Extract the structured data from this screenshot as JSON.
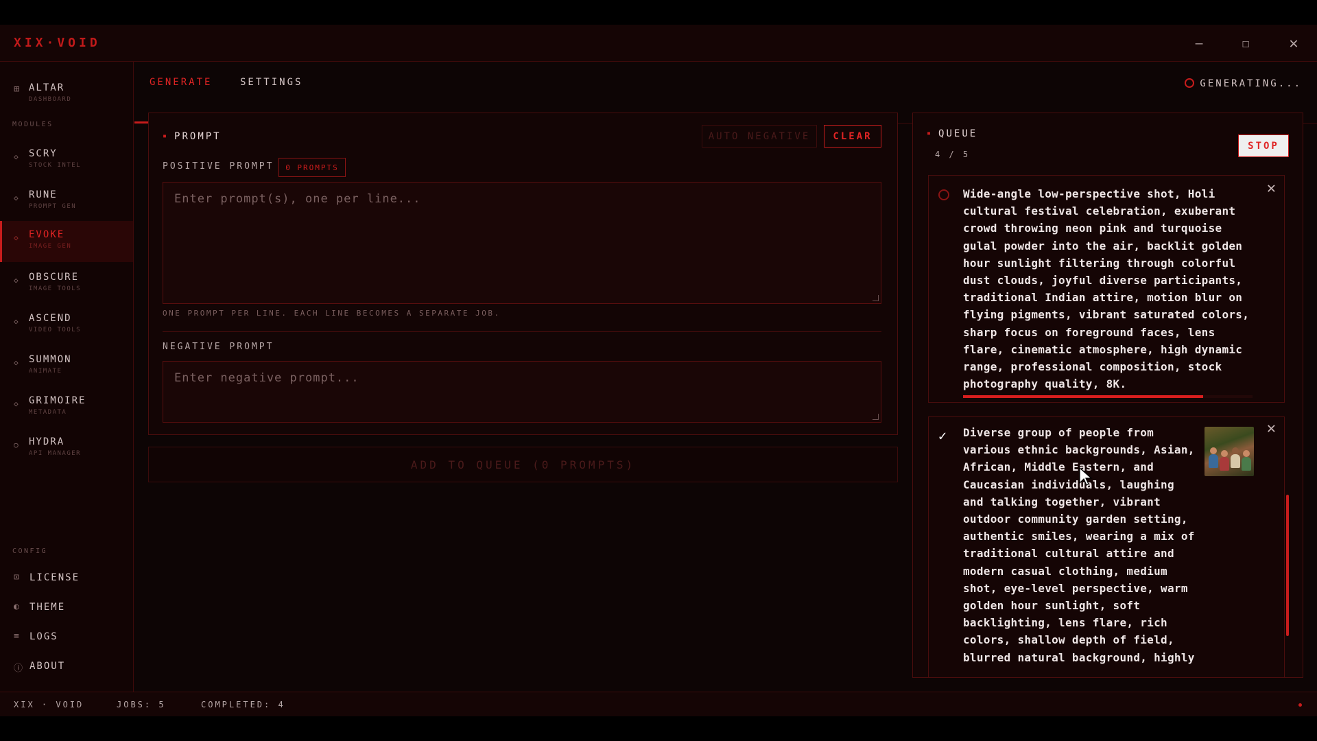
{
  "window": {
    "brand": "XIX·VOID",
    "minimize_icon": "minimize-icon",
    "maximize_icon": "maximize-icon",
    "close_icon": "close-icon"
  },
  "sidebar": {
    "top_item": {
      "label": "ALTAR",
      "sub": "DASHBOARD",
      "icon": "grid-icon"
    },
    "modules_heading": "MODULES",
    "modules": [
      {
        "label": "SCRY",
        "sub": "STOCK INTEL",
        "icon": "diamond-icon"
      },
      {
        "label": "RUNE",
        "sub": "PROMPT GEN",
        "icon": "diamond-icon"
      },
      {
        "label": "EVOKE",
        "sub": "IMAGE GEN",
        "icon": "diamond-icon",
        "active": true
      },
      {
        "label": "OBSCURE",
        "sub": "IMAGE TOOLS",
        "icon": "diamond-icon"
      },
      {
        "label": "ASCEND",
        "sub": "VIDEO TOOLS",
        "icon": "diamond-icon"
      },
      {
        "label": "SUMMON",
        "sub": "ANIMATE",
        "icon": "diamond-icon"
      },
      {
        "label": "GRIMOIRE",
        "sub": "METADATA",
        "icon": "diamond-icon"
      },
      {
        "label": "HYDRA",
        "sub": "API MANAGER",
        "icon": "circle-icon"
      }
    ],
    "config_heading": "CONFIG",
    "config": [
      {
        "label": "LICENSE",
        "icon": "license-icon"
      },
      {
        "label": "THEME",
        "icon": "theme-icon"
      },
      {
        "label": "LOGS",
        "icon": "logs-icon"
      },
      {
        "label": "ABOUT",
        "icon": "info-icon"
      }
    ]
  },
  "tabs": {
    "items": [
      {
        "label": "GENERATE",
        "active": true
      },
      {
        "label": "SETTINGS",
        "active": false
      }
    ],
    "status": "GENERATING..."
  },
  "prompt_panel": {
    "title": "PROMPT",
    "auto_negative_label": "AUTO NEGATIVE",
    "clear_label": "CLEAR",
    "positive_label": "POSITIVE PROMPT",
    "prompt_count_badge": "0 PROMPTS",
    "positive_placeholder": "Enter prompt(s), one per line...",
    "hint": "ONE PROMPT PER LINE. EACH LINE BECOMES A SEPARATE JOB.",
    "negative_label": "NEGATIVE PROMPT",
    "negative_placeholder": "Enter negative prompt..."
  },
  "add_to_queue_label": "ADD TO QUEUE (0 PROMPTS)",
  "queue": {
    "title": "QUEUE",
    "count": "4 / 5",
    "stop_label": "STOP",
    "jobs": [
      {
        "status": "running",
        "progress": 0.83,
        "lines": [
          "Wide-angle low-perspective shot, Holi",
          "cultural festival celebration, exuberant",
          "crowd throwing neon pink and turquoise",
          "gulal powder into the air, backlit golden",
          "hour sunlight filtering through colorful",
          "dust clouds, joyful diverse participants,",
          "traditional Indian attire, motion blur on",
          "flying pigments, vibrant saturated colors,",
          "sharp focus on foreground faces, lens",
          "flare, cinematic atmosphere, high dynamic",
          "range, professional composition, stock",
          "photography quality, 8K."
        ]
      },
      {
        "status": "completed",
        "lines": [
          "Diverse group of people from",
          "various ethnic backgrounds, Asian,",
          "African, Middle Eastern, and",
          "Caucasian individuals, laughing",
          "and talking together, vibrant",
          "outdoor community garden setting,",
          "authentic smiles, wearing a mix of",
          "traditional cultural attire and",
          "modern casual clothing, medium",
          "shot, eye-level perspective, warm",
          "golden hour sunlight, soft",
          "backlighting, lens flare, rich",
          "colors, shallow depth of field,",
          "blurred natural background, highly"
        ]
      }
    ]
  },
  "statusbar": {
    "app": "XIX · VOID",
    "jobs": "JOBS: 5",
    "completed": "COMPLETED: 4"
  },
  "colors": {
    "accent": "#c81c1c",
    "background": "#0d0505",
    "panel": "#130505"
  }
}
